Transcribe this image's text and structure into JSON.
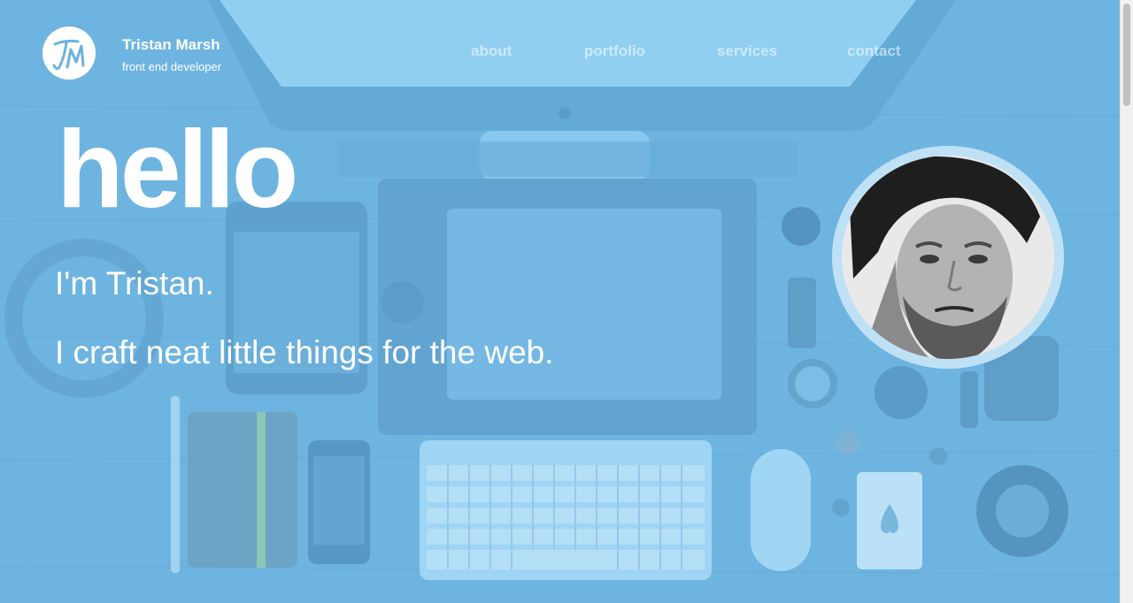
{
  "header": {
    "logo_icon": "tm-monogram-logo",
    "name": "Tristan Marsh",
    "tagline": "front end developer"
  },
  "nav": {
    "items": [
      {
        "label": "about"
      },
      {
        "label": "portfolio"
      },
      {
        "label": "services"
      },
      {
        "label": "contact"
      }
    ]
  },
  "hero": {
    "heading": "hello",
    "intro": "I'm Tristan.",
    "subtitle": "I craft neat little things for the web.",
    "avatar_icon": "profile-photo"
  },
  "colors": {
    "overlay": "#6fb6e2",
    "text": "#ffffff",
    "avatar_ring": "#bfe1f5"
  }
}
